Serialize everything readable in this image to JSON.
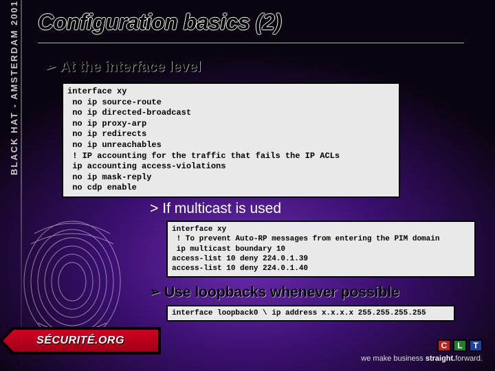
{
  "sidebar": {
    "text": "BLACK HAT - AMSTERDAM 2001"
  },
  "title": "Configuration basics (2)",
  "bullets": {
    "b1": "At the interface level",
    "b2": "If multicast is used",
    "b3": "Use loopbacks whenever possible"
  },
  "code": {
    "c1": "interface xy\n no ip source-route\n no ip directed-broadcast\n no ip proxy-arp\n no ip redirects\n no ip unreachables\n ! IP accounting for the traffic that fails the IP ACLs\n ip accounting access-violations\n no ip mask-reply\n no cdp enable",
    "c2": "interface xy\n ! To prevent Auto-RP messages from entering the PIM domain\n ip multicast boundary 10\naccess-list 10 deny 224.0.1.39\naccess-list 10 deny 224.0.1.40",
    "c3": "interface loopback0 \\ ip address x.x.x.x 255.255.255.255"
  },
  "logo": {
    "text": "SÉCURITÉ.ORG"
  },
  "footer": {
    "clt": [
      "C",
      "L",
      "T"
    ],
    "tagline_prefix": "we make business ",
    "tagline_bold": "straight.",
    "tagline_suffix": "forward."
  }
}
